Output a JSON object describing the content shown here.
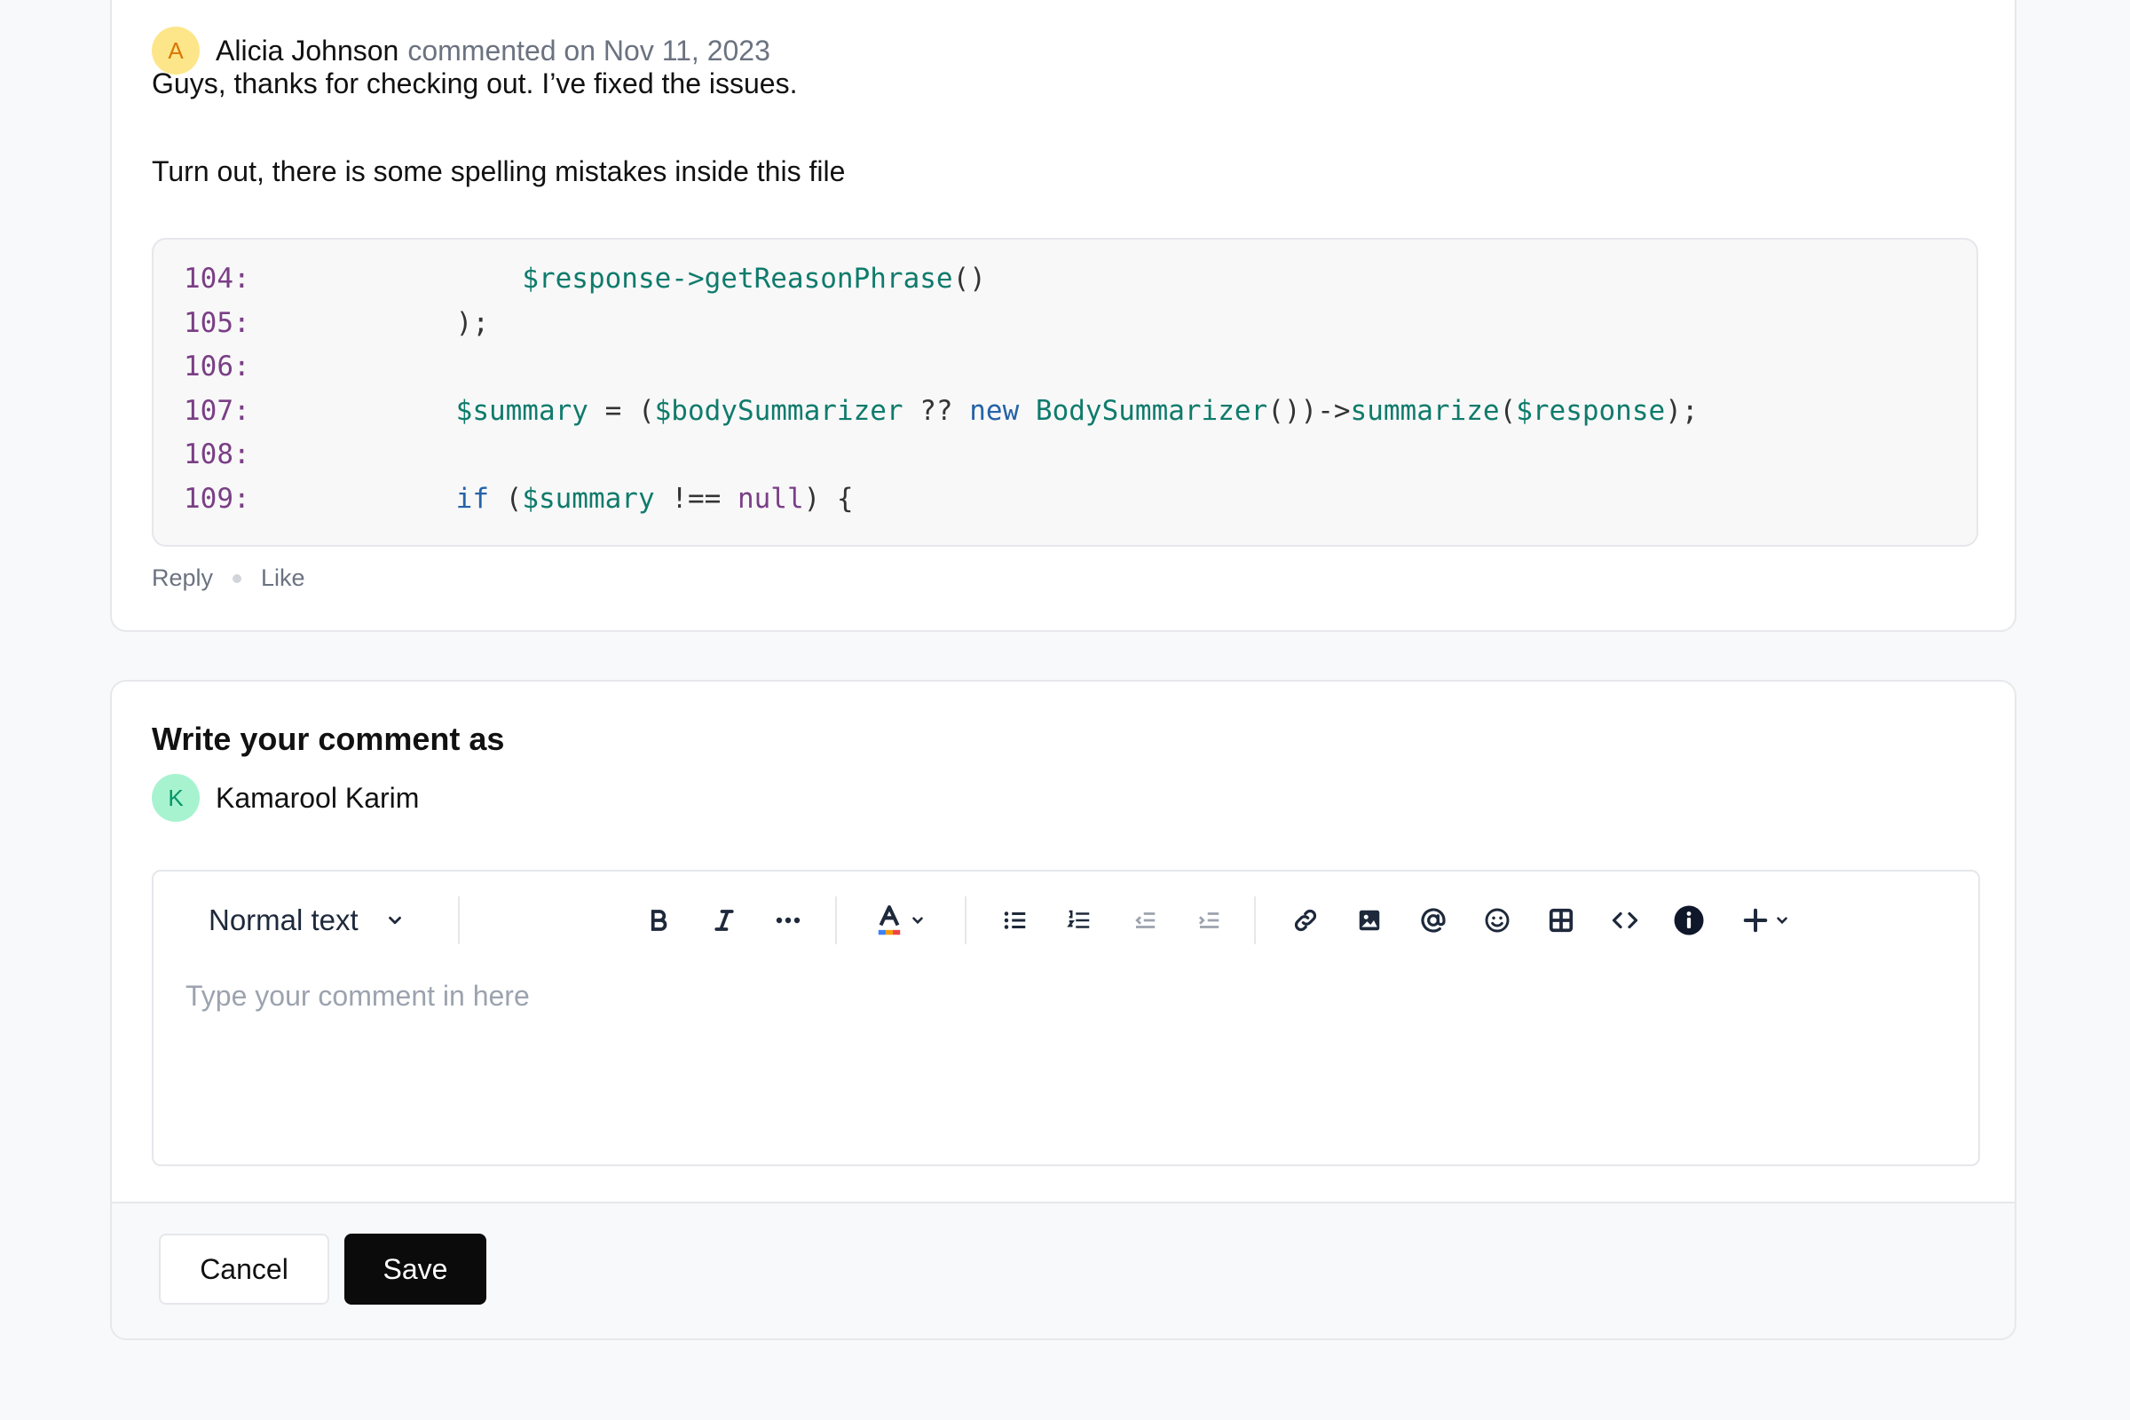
{
  "comment": {
    "avatar_initial": "A",
    "author": "Alicia Johnson",
    "meta": "commented on Nov 11, 2023",
    "line1": "Guys, thanks for checking out. I’ve fixed the issues.",
    "line2": "Turn out, there is some spelling mistakes inside this file",
    "code": [
      {
        "num": "104:",
        "tokens": [
          {
            "t": "        ",
            "c": "plain"
          },
          {
            "t": "$response->getReasonPhrase",
            "c": "var"
          },
          {
            "t": "()",
            "c": "plain"
          }
        ]
      },
      {
        "num": "105:",
        "tokens": [
          {
            "t": "    );",
            "c": "plain"
          }
        ]
      },
      {
        "num": "106:",
        "tokens": []
      },
      {
        "num": "107:",
        "tokens": [
          {
            "t": "    ",
            "c": "plain"
          },
          {
            "t": "$summary",
            "c": "var"
          },
          {
            "t": " = (",
            "c": "plain"
          },
          {
            "t": "$bodySummarizer",
            "c": "var"
          },
          {
            "t": " ?? ",
            "c": "plain"
          },
          {
            "t": "new",
            "c": "kw"
          },
          {
            "t": " ",
            "c": "plain"
          },
          {
            "t": "BodySummarizer",
            "c": "var"
          },
          {
            "t": "())->",
            "c": "plain"
          },
          {
            "t": "summarize",
            "c": "var"
          },
          {
            "t": "(",
            "c": "plain"
          },
          {
            "t": "$response",
            "c": "var"
          },
          {
            "t": ");",
            "c": "plain"
          }
        ]
      },
      {
        "num": "108:",
        "tokens": []
      },
      {
        "num": "109:",
        "tokens": [
          {
            "t": "    ",
            "c": "plain"
          },
          {
            "t": "if",
            "c": "kw"
          },
          {
            "t": " (",
            "c": "plain"
          },
          {
            "t": "$summary",
            "c": "var"
          },
          {
            "t": " !== ",
            "c": "plain"
          },
          {
            "t": "null",
            "c": "lit"
          },
          {
            "t": ") {",
            "c": "plain"
          }
        ]
      }
    ],
    "actions": {
      "reply": "Reply",
      "like": "Like"
    }
  },
  "compose": {
    "title": "Write your comment as",
    "avatar_initial": "K",
    "user_name": "Kamarool Karim",
    "text_style": "Normal text",
    "placeholder": "Type your comment in here",
    "toolbar_icons": [
      "bold-icon",
      "italic-icon",
      "more-formatting-icon",
      "text-color-icon",
      "bullet-list-icon",
      "numbered-list-icon",
      "outdent-icon",
      "indent-icon",
      "link-icon",
      "image-icon",
      "mention-icon",
      "emoji-icon",
      "table-icon",
      "code-icon",
      "info-icon",
      "insert-more-icon"
    ],
    "cancel_label": "Cancel",
    "save_label": "Save"
  },
  "colors": {
    "primary_button": "#0b0b0b",
    "avatar_a_bg": "#fde68a",
    "avatar_k_bg": "#a7f3d0",
    "code_var": "#0f7b6c",
    "code_keyword": "#2563a8",
    "line_number": "#7a3e86"
  }
}
